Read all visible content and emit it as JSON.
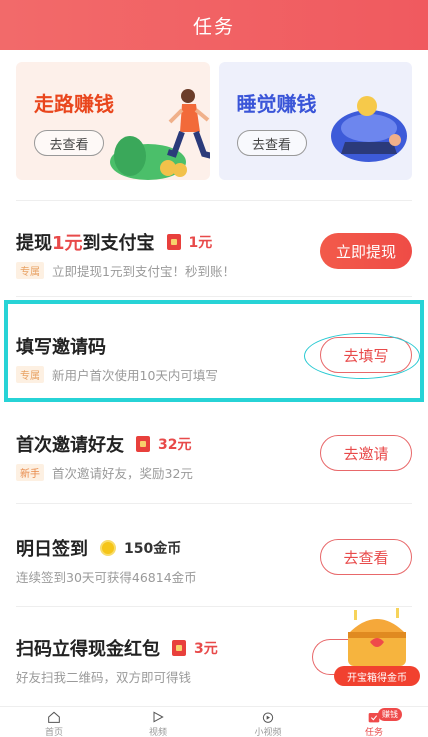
{
  "header": {
    "title": "任务"
  },
  "cards": [
    {
      "title": "走路赚钱",
      "button": "去查看"
    },
    {
      "title": "睡觉赚钱",
      "button": "去查看"
    }
  ],
  "tasks": [
    {
      "name_parts": [
        "提现",
        "1元",
        "到支付宝"
      ],
      "reward": "1元",
      "tag": "专属",
      "desc": "立即提现1元到支付宝！秒到账！",
      "button": "立即提现"
    },
    {
      "name": "填写邀请码",
      "tag": "专属",
      "desc": "新用户首次使用10天内可填写",
      "button": "去填写"
    },
    {
      "name": "首次邀请好友",
      "reward": "32元",
      "tag": "新手",
      "desc": "首次邀请好友，奖励32元",
      "button": "去邀请"
    },
    {
      "name": "明日签到",
      "reward": "150金币",
      "desc": "连续签到30天可获得46814金币",
      "button": "去查看"
    },
    {
      "name": "扫码立得现金红包",
      "reward": "3元",
      "desc": "好友扫我二维码，双方即可得钱",
      "button": ""
    }
  ],
  "chest": {
    "label": "开宝箱得金币"
  },
  "tabbar": {
    "items": [
      {
        "label": "首页",
        "icon": "home-icon"
      },
      {
        "label": "视频",
        "icon": "play-icon"
      },
      {
        "label": "小视频",
        "icon": "short-video-icon"
      },
      {
        "label": "任务",
        "icon": "task-icon",
        "badge": "赚钱"
      }
    ]
  },
  "colors": {
    "accent": "#ef4a4a",
    "highlight": "#27d3d6"
  }
}
